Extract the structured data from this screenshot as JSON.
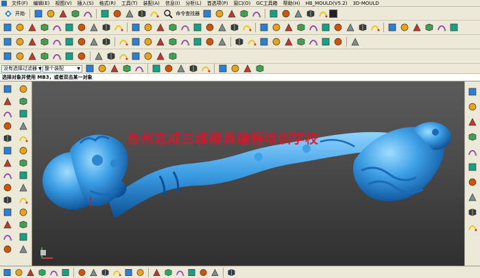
{
  "menu": {
    "items": [
      "文件(F)",
      "编辑(E)",
      "视图(V)",
      "插入(S)",
      "格式(R)",
      "工具(T)",
      "装配(A)",
      "信息(I)",
      "分析(L)",
      "首选项(P)",
      "窗口(O)",
      "GC工具箱",
      "帮助(H)",
      "HB_MOULD(V5.2)",
      "3D-MOULD"
    ]
  },
  "toolbar1": {
    "start_label": "开始·",
    "command_finder_label": "命令查找器"
  },
  "filterbar": {
    "type_filter": "没有选择过滤器",
    "scope_filter": "整个装配"
  },
  "cue_line": "选择对象并使用 MB3，或者双击某一对象",
  "viewport": {
    "watermark": "台州志成三维模具编程培训学校",
    "model_color": "#3ea0e6",
    "background_top": "#5b5b5b",
    "background_bottom": "#2f2f2f"
  },
  "icons": {
    "toolbar1": [
      "open-icon",
      "save-icon",
      "cut-icon",
      "copy-icon",
      "paste-icon",
      "undo-icon",
      "redo-icon",
      "wireframe-icon",
      "shaded-icon",
      "fit-view-icon",
      "zoom-icon",
      "rotate-icon",
      "pan-icon",
      "view-orient-icon",
      "render-style-icon",
      "layer-icon",
      "color-icon",
      "display-icon",
      "hide-icon",
      "show-icon"
    ],
    "toolbar2": [
      "line-icon",
      "arc-icon",
      "circle-icon",
      "spline-icon",
      "point-icon",
      "point-set-icon",
      "rectangle-icon",
      "polygon-icon",
      "ellipse-icon",
      "text-icon",
      "extrude-icon",
      "revolve-icon",
      "hole-icon",
      "boss-icon",
      "pocket-icon",
      "pad-icon",
      "slot-icon",
      "groove-icon",
      "unite-icon",
      "subtract-icon",
      "intersect-icon",
      "trim-body-icon",
      "split-body-icon",
      "edge-blend-icon",
      "chamfer-icon",
      "shell-icon",
      "draft-icon",
      "offset-face-icon",
      "scale-body-icon",
      "thicken-icon",
      "sew-icon",
      "patch-icon",
      "replace-face-icon",
      "datum-plane-icon",
      "datum-axis-icon",
      "datum-csys-icon"
    ],
    "toolbar3": [
      "through-curves-icon",
      "through-mesh-icon",
      "swept-icon",
      "ruled-icon",
      "n-sided-icon",
      "bounded-plane-icon",
      "fill-surface-icon",
      "studio-surface-icon",
      "extension-icon",
      "law-extension-icon",
      "offset-surface-icon",
      "trim-sheet-icon",
      "join-curve-icon",
      "project-curve-icon",
      "intersect-curve-icon",
      "section-curve-icon",
      "isoparametric-icon",
      "bridge-curve-icon",
      "offset-curve-icon",
      "wrap-curve-icon",
      "combine-curve-icon",
      "mirror-icon",
      "pattern-icon",
      "extract-icon",
      "mold-wizard-icon",
      "parting-icon",
      "core-cavity-icon",
      "electrode-icon"
    ],
    "toolbar4": [
      "cam-setup-icon",
      "create-program-icon",
      "create-tool-icon",
      "create-geometry-icon",
      "create-method-icon",
      "create-operation-icon",
      "generate-path-icon",
      "verify-icon",
      "post-process-icon",
      "shop-doc-icon",
      "fixed-contour-icon",
      "cavity-mill-icon",
      "zlevel-icon",
      "drill-icon"
    ],
    "filterbar": [
      "select-all-icon",
      "deselect-icon",
      "feature-select-icon",
      "face-select-icon",
      "edge-select-icon",
      "point-endpoint-icon",
      "point-midpoint-icon",
      "point-control-icon",
      "point-intersection-icon",
      "point-center-icon",
      "point-quadrant-icon",
      "point-existing-icon",
      "point-on-curve-icon",
      "snap-settings-icon"
    ],
    "left": [
      "part-navigator-icon",
      "assembly-icon",
      "history-icon",
      "reuse-icon",
      "role-icon",
      "system-materials-icon",
      "web-browser-icon",
      "history-mode-icon",
      "hd3d-icon",
      "process-icon",
      "block-icon",
      "cylinder-icon",
      "cone-icon",
      "sphere-icon",
      "tube-icon",
      "thread-icon",
      "rib-icon",
      "emboss-icon",
      "face-blend-icon",
      "soft-blend-icon",
      "var-blend-icon",
      "corner-icon",
      "draft-body-icon",
      "taper-icon",
      "sweep-guide-icon",
      "styled-sweep-icon",
      "blend-icon",
      "global-shape-icon"
    ],
    "right": [
      "reuse-library-icon",
      "hd3d-tools-icon",
      "palette-icon",
      "history-icon",
      "web-icon",
      "shading-icon",
      "roles-icon",
      "materials-icon",
      "help-icon",
      "lock-icon"
    ],
    "status": [
      "select-icon",
      "snap-icon",
      "curve-rule-icon",
      "face-rule-icon",
      "snap-point-icon",
      "coordinate-icon",
      "measure-icon",
      "section-icon",
      "clipping-icon",
      "view-triad-icon",
      "render-icon",
      "orient-icon",
      "layer-visibility-icon",
      "camera-icon",
      "light-icon",
      "background-icon",
      "edit-icon",
      "analysis-icon",
      "snapshot-icon"
    ]
  }
}
